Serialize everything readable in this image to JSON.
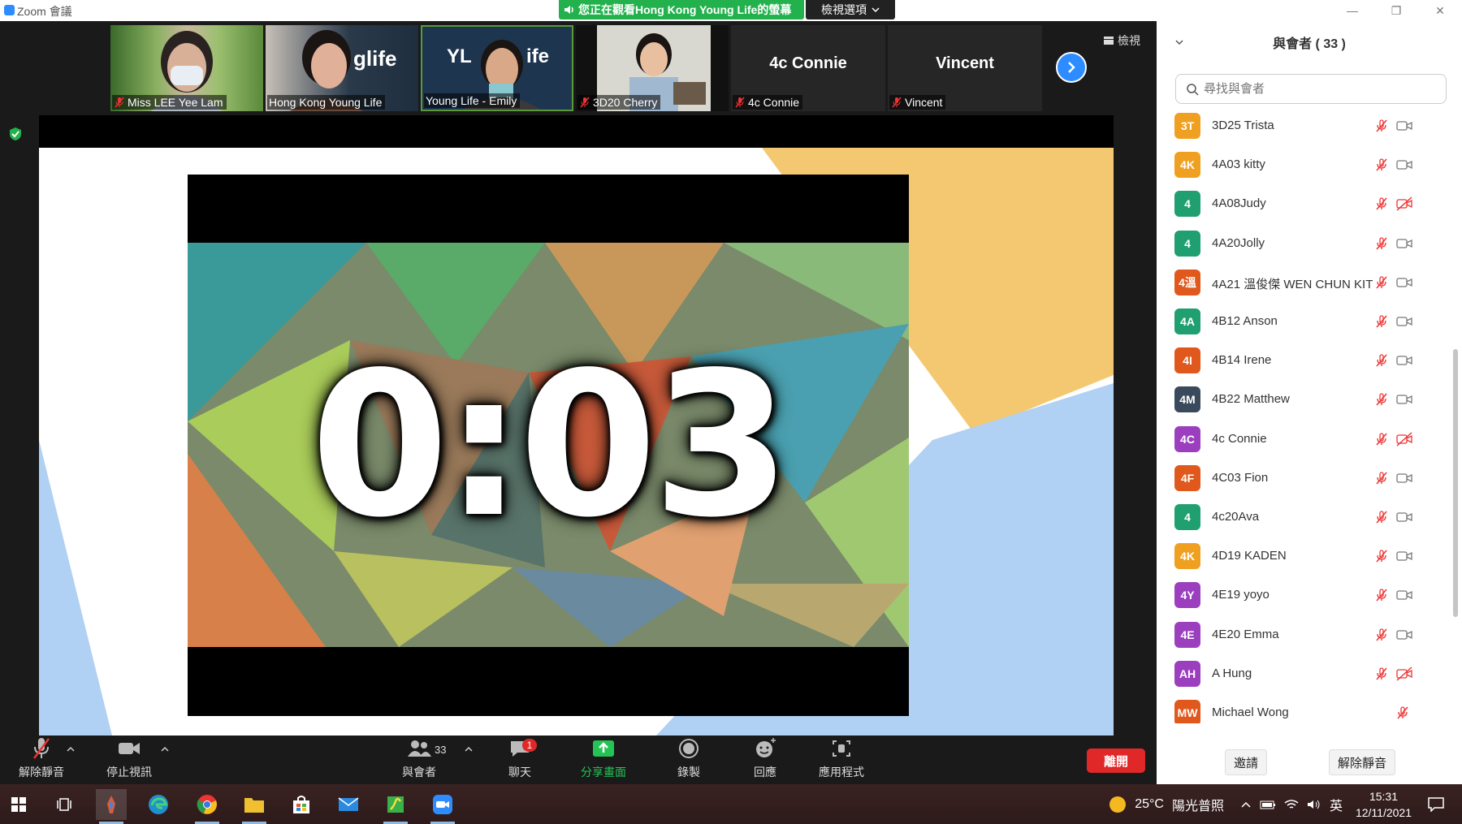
{
  "window": {
    "title": "Zoom 會議"
  },
  "banner": {
    "viewing_text": "您正在觀看Hong Kong Young Life的螢幕",
    "view_options": "檢視選項"
  },
  "strip": {
    "view_label": "檢視",
    "tiles": [
      {
        "name": "Miss LEE Yee Lam",
        "muted": true
      },
      {
        "name": "Hong Kong Young Life",
        "muted": false
      },
      {
        "name": "Young Life - Emily",
        "muted": false
      },
      {
        "name": "3D20 Cherry",
        "muted": true
      },
      {
        "name": "4c Connie",
        "big": "4c Connie",
        "muted": true
      },
      {
        "name": "Vincent",
        "big": "Vincent",
        "muted": true
      }
    ]
  },
  "shared": {
    "timer_text": "0:03"
  },
  "toolbar": {
    "unmute": "解除靜音",
    "stop_video": "停止視訊",
    "participants": "與會者",
    "participant_count": "33",
    "chat": "聊天",
    "chat_badge": "1",
    "share": "分享畫面",
    "record": "錄製",
    "reactions": "回應",
    "apps": "應用程式",
    "leave": "離開"
  },
  "panel": {
    "title": "與會者 ( 33 )",
    "search_placeholder": "尋找與會者",
    "invite": "邀請",
    "unmute_all": "解除靜音",
    "participants": [
      {
        "initials": "3T",
        "name": "3D25 Trista",
        "color": "#f0a020",
        "video_off": false
      },
      {
        "initials": "4K",
        "name": "4A03 kitty",
        "color": "#f0a020",
        "video_off": false
      },
      {
        "initials": "4",
        "name": "4A08Judy",
        "color": "#20a070",
        "video_off": true
      },
      {
        "initials": "4",
        "name": "4A20Jolly",
        "color": "#20a070",
        "video_off": false
      },
      {
        "initials": "4溫",
        "name": "4A21 溫俊傑 WEN CHUN KIT",
        "color": "#e0581c",
        "video_off": false
      },
      {
        "initials": "4A",
        "name": "4B12 Anson",
        "color": "#20a070",
        "video_off": false
      },
      {
        "initials": "4I",
        "name": "4B14 Irene",
        "color": "#e0581c",
        "video_off": false
      },
      {
        "initials": "4M",
        "name": "4B22 Matthew",
        "color": "#3a4a5c",
        "video_off": false
      },
      {
        "initials": "4C",
        "name": "4c Connie",
        "color": "#9b3fbf",
        "video_off": true
      },
      {
        "initials": "4F",
        "name": "4C03 Fion",
        "color": "#e0581c",
        "video_off": false
      },
      {
        "initials": "4",
        "name": "4c20Ava",
        "color": "#20a070",
        "video_off": false
      },
      {
        "initials": "4K",
        "name": "4D19 KADEN",
        "color": "#f0a020",
        "video_off": false
      },
      {
        "initials": "4Y",
        "name": "4E19 yoyo",
        "color": "#9b3fbf",
        "video_off": false
      },
      {
        "initials": "4E",
        "name": "4E20 Emma",
        "color": "#9b3fbf",
        "video_off": false
      },
      {
        "initials": "AH",
        "name": "A Hung",
        "color": "#9b3fbf",
        "video_off": true
      },
      {
        "initials": "MW",
        "name": "Michael Wong",
        "color": "#e0581c",
        "video_off": null
      }
    ]
  },
  "taskbar": {
    "temperature": "25°C",
    "weather": "陽光普照",
    "ime": "英",
    "time": "15:31",
    "date": "12/11/2021"
  }
}
